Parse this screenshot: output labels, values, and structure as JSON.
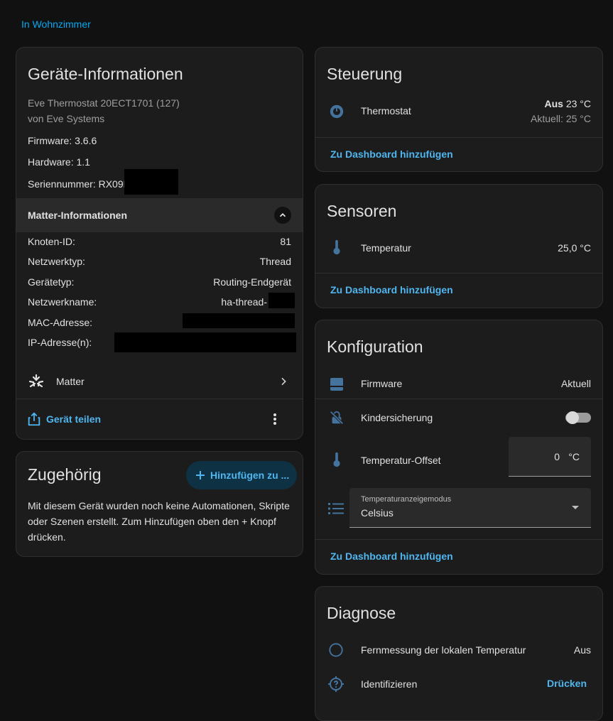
{
  "breadcrumb": "In Wohnzimmer",
  "device_info": {
    "title": "Geräte-Informationen",
    "model": "Eve Thermostat 20ECT1701 (127)",
    "manufacturer": "von Eve Systems",
    "firmware": "Firmware: 3.6.6",
    "hardware": "Hardware: 1.1",
    "serial": "Seriennummer: RX09F",
    "matter_header": "Matter-Informationen",
    "matter_rows": [
      {
        "label": "Knoten-ID:",
        "value": "81"
      },
      {
        "label": "Netzwerktyp:",
        "value": "Thread"
      },
      {
        "label": "Gerätetyp:",
        "value": "Routing-Endgerät"
      },
      {
        "label": "Netzwerkname:",
        "value": "ha-thread-"
      },
      {
        "label": "MAC-Adresse:",
        "value": ""
      },
      {
        "label": "IP-Adresse(n):",
        "value": ""
      }
    ],
    "integration": "Matter",
    "share": "Gerät teilen"
  },
  "related": {
    "title": "Zugehörig",
    "add_button": "Hinzufügen zu ...",
    "text": "Mit diesem Gerät wurden noch keine Automationen, Skripte oder Szenen erstellt. Zum Hinzufügen oben den + Knopf drücken."
  },
  "controls": {
    "title": "Steuerung",
    "thermostat_label": "Thermostat",
    "state_off": "Aus",
    "state_temp": "23 °C",
    "current": "Aktuell: 25 °C",
    "add_dashboard": "Zu Dashboard hinzufügen"
  },
  "sensors": {
    "title": "Sensoren",
    "temperature_label": "Temperatur",
    "temperature_value": "25,0 °C",
    "add_dashboard": "Zu Dashboard hinzufügen"
  },
  "config": {
    "title": "Konfiguration",
    "firmware_label": "Firmware",
    "firmware_value": "Aktuell",
    "child_lock_label": "Kindersicherung",
    "offset_label": "Temperatur-Offset",
    "offset_value": "0",
    "offset_unit": "°C",
    "display_mode_label": "Temperaturanzeigemodus",
    "display_mode_value": "Celsius",
    "add_dashboard": "Zu Dashboard hinzufügen"
  },
  "diagnostics": {
    "title": "Diagnose",
    "remote_label": "Fernmessung der lokalen Temperatur",
    "remote_value": "Aus",
    "identify_label": "Identifizieren",
    "identify_button": "Drücken"
  },
  "colors": {
    "background": "#111111",
    "card": "#1c1c1c",
    "accent": "#03a9f4",
    "icon": "#44739e"
  }
}
